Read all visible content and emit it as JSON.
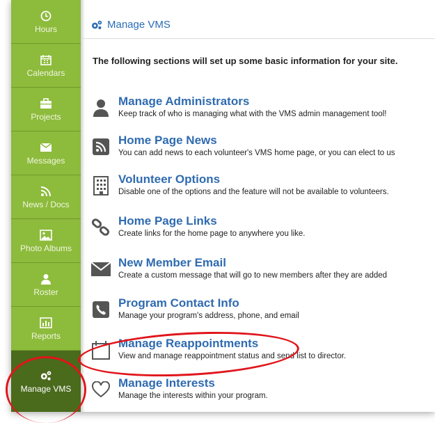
{
  "sidebar": {
    "items": [
      {
        "label": "Hours",
        "icon": "clock-icon"
      },
      {
        "label": "Calendars",
        "icon": "calendar-icon"
      },
      {
        "label": "Projects",
        "icon": "briefcase-icon"
      },
      {
        "label": "Messages",
        "icon": "envelope-icon"
      },
      {
        "label": "News / Docs",
        "icon": "rss-icon"
      },
      {
        "label": "Photo Albums",
        "icon": "image-icon"
      },
      {
        "label": "Roster",
        "icon": "person-icon"
      },
      {
        "label": "Reports",
        "icon": "bar-chart-icon"
      },
      {
        "label": "Manage VMS",
        "icon": "gears-icon",
        "active": true
      }
    ]
  },
  "header": {
    "title": "Manage VMS"
  },
  "intro": "The following sections will set up some basic information for your site.",
  "sections": [
    {
      "title": "Manage Administrators",
      "desc": "Keep track of who is managing what with the VMS admin management tool!",
      "icon": "user-icon"
    },
    {
      "title": "Home Page News",
      "desc": "You can add news to each volunteer's VMS home page, or you can elect to us",
      "icon": "rss-square-icon"
    },
    {
      "title": "Volunteer Options",
      "desc": "Disable one of the options and the feature will not be available to volunteers.",
      "icon": "building-icon"
    },
    {
      "title": "Home Page Links",
      "desc": "Create links for the home page to anywhere you like.",
      "icon": "link-icon"
    },
    {
      "title": "New Member Email",
      "desc": "Create a custom message that will go to new members after they are added",
      "icon": "envelope-icon"
    },
    {
      "title": "Program Contact Info",
      "desc": "Manage your program's address, phone, and email",
      "icon": "phone-square-icon"
    },
    {
      "title": "Manage Reappointments",
      "desc": "View and manage reappointment status and send list to director.",
      "icon": "calendar-icon"
    },
    {
      "title": "Manage Interests",
      "desc": "Manage the interests within your program.",
      "icon": "heart-icon"
    }
  ],
  "colors": {
    "sidebar": "#8dbb3c",
    "active": "#4a6a1c",
    "link": "#2f6bb0",
    "annotation": "#e0151b"
  }
}
